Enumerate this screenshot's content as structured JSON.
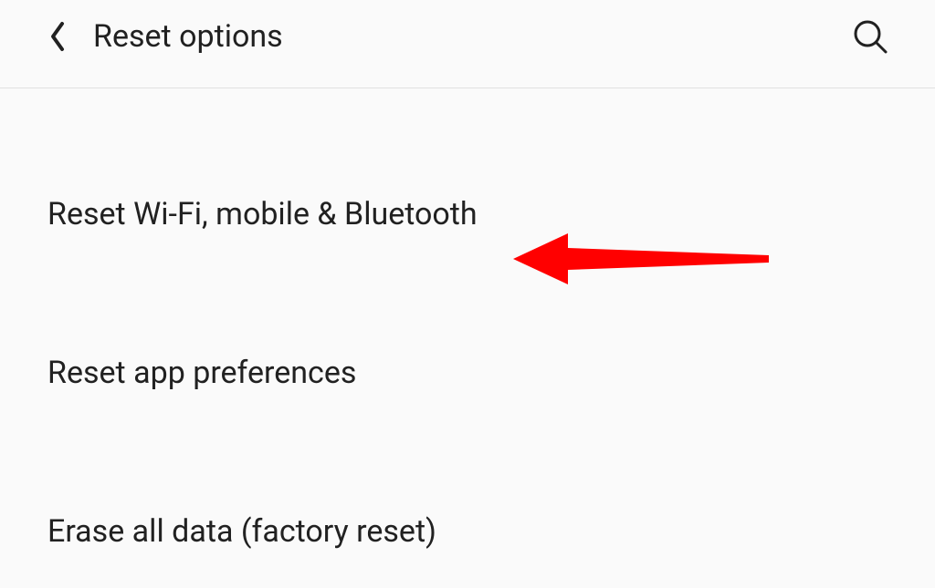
{
  "header": {
    "title": "Reset options"
  },
  "options": [
    {
      "label": "Reset Wi-Fi, mobile & Bluetooth"
    },
    {
      "label": "Reset app preferences"
    },
    {
      "label": "Erase all data (factory reset)"
    }
  ]
}
